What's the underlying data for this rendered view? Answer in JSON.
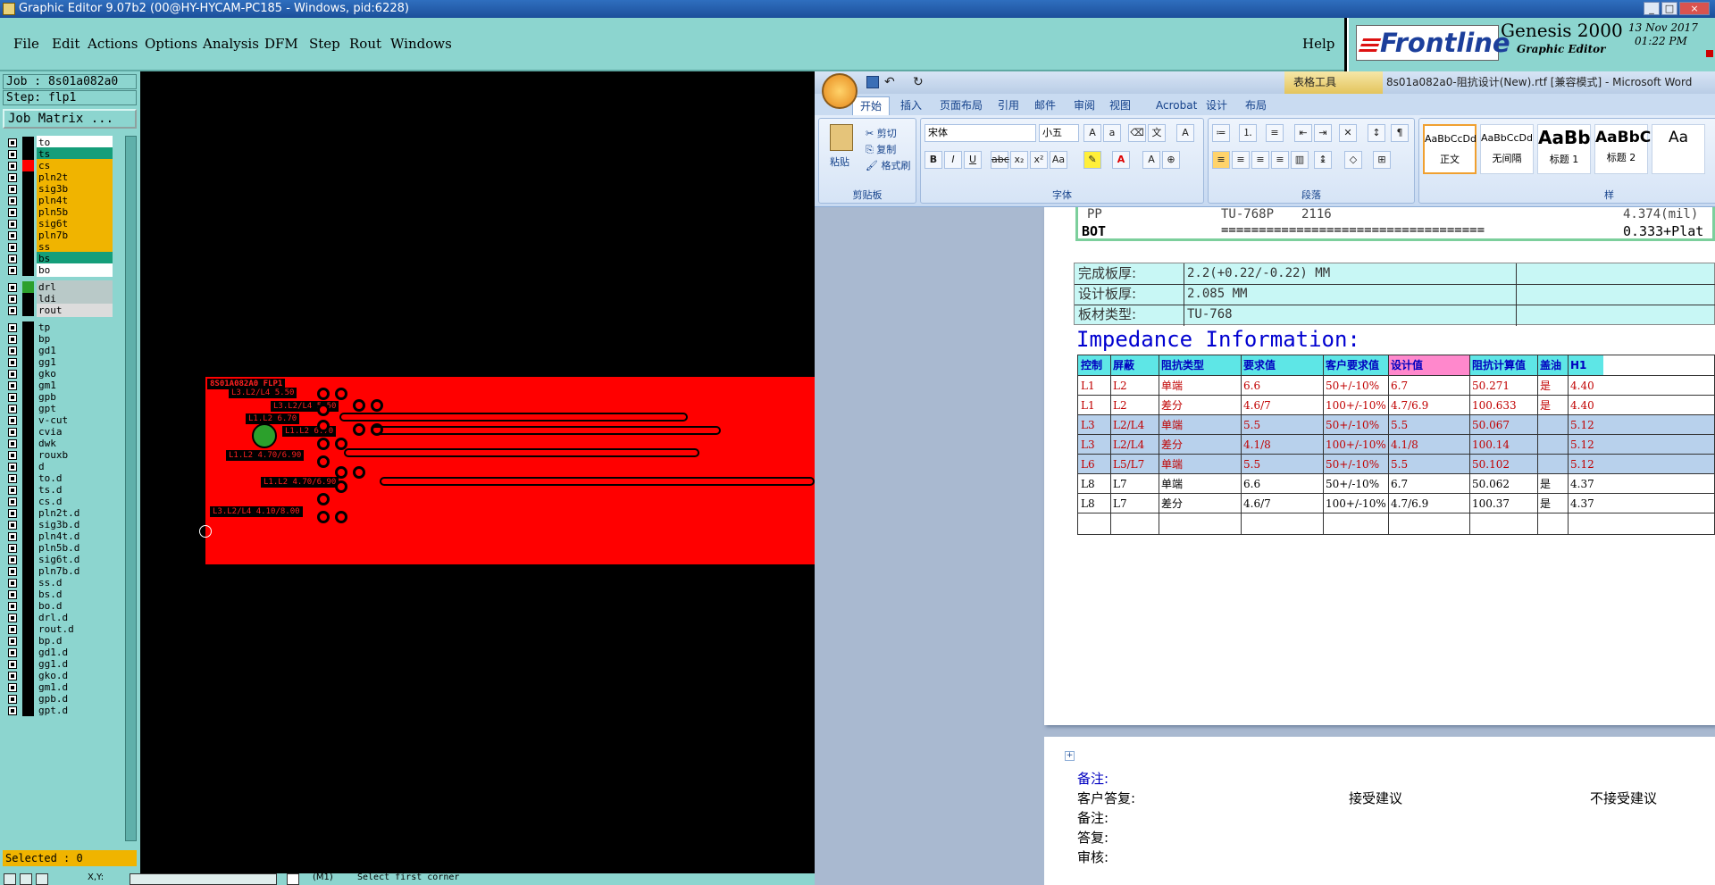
{
  "title": "Graphic Editor 9.07b2 (00@HY-HYCAM-PC185 - Windows, pid:6228)",
  "menu": [
    "File",
    "Edit",
    "Actions",
    "Options",
    "Analysis",
    "DFM",
    "Step",
    "Rout",
    "Windows"
  ],
  "help": "Help",
  "logo": {
    "brand": "Frontline",
    "product": "Genesis 2000",
    "sub": "Graphic Editor",
    "date": "13 Nov 2017",
    "time": "01:22 PM"
  },
  "job": "Job : 8s01a082a0",
  "step": "Step: flp1",
  "job_matrix": "Job Matrix ...",
  "layers": [
    {
      "name": "to",
      "color": "#ffffff"
    },
    {
      "name": "ts",
      "color": "#159e7a"
    },
    {
      "name": "cs",
      "color": "#f0b400",
      "sel": true
    },
    {
      "name": "pln2t",
      "color": "#f0b400"
    },
    {
      "name": "sig3b",
      "color": "#f0b400"
    },
    {
      "name": "pln4t",
      "color": "#f0b400"
    },
    {
      "name": "pln5b",
      "color": "#f0b400"
    },
    {
      "name": "sig6t",
      "color": "#f0b400"
    },
    {
      "name": "pln7b",
      "color": "#f0b400"
    },
    {
      "name": "ss",
      "color": "#f0b400"
    },
    {
      "name": "bs",
      "color": "#159e7a"
    },
    {
      "name": "bo",
      "color": "#ffffff"
    },
    {
      "name": "drl",
      "color": "#b9c9c8",
      "gap": true
    },
    {
      "name": "ldi",
      "color": "#b9c9c8"
    },
    {
      "name": "rout",
      "color": "#dcdcdc"
    },
    {
      "name": "tp",
      "color": "#8cd5cf",
      "gap": true
    },
    {
      "name": "bp",
      "color": "#8cd5cf"
    },
    {
      "name": "gd1",
      "color": "#8cd5cf"
    },
    {
      "name": "gg1",
      "color": "#8cd5cf"
    },
    {
      "name": "gko",
      "color": "#8cd5cf"
    },
    {
      "name": "gm1",
      "color": "#8cd5cf"
    },
    {
      "name": "gpb",
      "color": "#8cd5cf"
    },
    {
      "name": "gpt",
      "color": "#8cd5cf"
    },
    {
      "name": "v-cut",
      "color": "#8cd5cf"
    },
    {
      "name": "cvia",
      "color": "#8cd5cf"
    },
    {
      "name": "dwk",
      "color": "#8cd5cf"
    },
    {
      "name": "rouxb",
      "color": "#8cd5cf"
    },
    {
      "name": "d",
      "color": "#8cd5cf"
    },
    {
      "name": "to.d",
      "color": "#8cd5cf"
    },
    {
      "name": "ts.d",
      "color": "#8cd5cf"
    },
    {
      "name": "cs.d",
      "color": "#8cd5cf"
    },
    {
      "name": "pln2t.d",
      "color": "#8cd5cf"
    },
    {
      "name": "sig3b.d",
      "color": "#8cd5cf"
    },
    {
      "name": "pln4t.d",
      "color": "#8cd5cf"
    },
    {
      "name": "pln5b.d",
      "color": "#8cd5cf"
    },
    {
      "name": "sig6t.d",
      "color": "#8cd5cf"
    },
    {
      "name": "pln7b.d",
      "color": "#8cd5cf"
    },
    {
      "name": "ss.d",
      "color": "#8cd5cf"
    },
    {
      "name": "bs.d",
      "color": "#8cd5cf"
    },
    {
      "name": "bo.d",
      "color": "#8cd5cf"
    },
    {
      "name": "drl.d",
      "color": "#8cd5cf"
    },
    {
      "name": "rout.d",
      "color": "#8cd5cf"
    },
    {
      "name": "bp.d",
      "color": "#8cd5cf"
    },
    {
      "name": "gd1.d",
      "color": "#8cd5cf"
    },
    {
      "name": "gg1.d",
      "color": "#8cd5cf"
    },
    {
      "name": "gko.d",
      "color": "#8cd5cf"
    },
    {
      "name": "gm1.d",
      "color": "#8cd5cf"
    },
    {
      "name": "gpb.d",
      "color": "#8cd5cf"
    },
    {
      "name": "gpt.d",
      "color": "#8cd5cf"
    }
  ],
  "selected": "Selected : 0",
  "status": {
    "xy": "X,Y:",
    "hint": "Select first corner",
    "mode": "(M1)"
  },
  "pcb": {
    "header": "8S01A082A0 FLP1",
    "labels": [
      "L3.L2/L4 5.50",
      "L3.L2/L4 5.50",
      "L1.L2 6.70",
      "L1.L2 6.70",
      "L1.L2 4.70/6.90",
      "L1.L2 4.70/6.90",
      "L3.L2/L4 4.10/8.00"
    ]
  },
  "word": {
    "title": "8s01a082a0-阻抗设计(New).rtf [兼容模式] - Microsoft Word",
    "table_tools": "表格工具",
    "tabs": [
      "开始",
      "插入",
      "页面布局",
      "引用",
      "邮件",
      "审阅",
      "视图",
      "Acrobat",
      "设计",
      "布局"
    ],
    "font": "宋体",
    "size": "小五",
    "clipboard": {
      "paste": "粘贴",
      "cut": "剪切",
      "copy": "复制",
      "format": "格式刷",
      "label": "剪贴板"
    },
    "font_label": "字体",
    "para_label": "段落",
    "styles": [
      {
        "sample": "AaBbCcDd",
        "name": "正文"
      },
      {
        "sample": "AaBbCcDd",
        "name": "无间隔"
      },
      {
        "sample": "AaBb",
        "name": "标题 1"
      },
      {
        "sample": "AaBbC",
        "name": "标题 2"
      },
      {
        "sample": "Aa",
        "name": ""
      }
    ],
    "styles_label": "样",
    "stackup": [
      {
        "a": "PP",
        "b": "TU-768P",
        "c": "2116",
        "d": "4.374(mil)"
      },
      {
        "a": "BOT",
        "b": "===================================",
        "c": "",
        "d": "0.333+Plat"
      }
    ],
    "board": [
      {
        "label": "完成板厚:",
        "value": "2.2(+0.22/-0.22) MM"
      },
      {
        "label": "设计板厚:",
        "value": "2.085 MM"
      },
      {
        "label": "板材类型:",
        "value": "TU-768"
      }
    ],
    "imp_title": "Impedance Information:",
    "imp_headers": [
      "控制",
      "屏蔽",
      "阻抗类型",
      "要求值",
      "客户要求值",
      "设计值",
      "阻抗计算值",
      "盖油",
      "H1"
    ],
    "imp_rows": [
      [
        "L1",
        "L2",
        "单端",
        "6.6",
        "50+/-10%",
        "6.7",
        "50.271",
        "是",
        "4.40"
      ],
      [
        "L1",
        "L2",
        "差分",
        "4.6/7",
        "100+/-10%",
        "4.7/6.9",
        "100.633",
        "是",
        "4.40"
      ],
      [
        "L3",
        "L2/L4",
        "单端",
        "5.5",
        "50+/-10%",
        "5.5",
        "50.067",
        "",
        "5.12"
      ],
      [
        "L3",
        "L2/L4",
        "差分",
        "4.1/8",
        "100+/-10%",
        "4.1/8",
        "100.14",
        "",
        "5.12"
      ],
      [
        "L6",
        "L5/L7",
        "单端",
        "5.5",
        "50+/-10%",
        "5.5",
        "50.102",
        "",
        "5.12"
      ],
      [
        "L8",
        "L7",
        "单端",
        "6.6",
        "50+/-10%",
        "6.7",
        "50.062",
        "是",
        "4.37"
      ],
      [
        "L8",
        "L7",
        "差分",
        "4.6/7",
        "100+/-10%",
        "4.7/6.9",
        "100.37",
        "是",
        "4.37"
      ]
    ],
    "notes": {
      "remark": "备注:",
      "reply": "客户答复:",
      "accept": "接受建议",
      "reject": "不接受建议",
      "remark2": "备注:",
      "answer": "答复:",
      "review": "审核:"
    }
  }
}
